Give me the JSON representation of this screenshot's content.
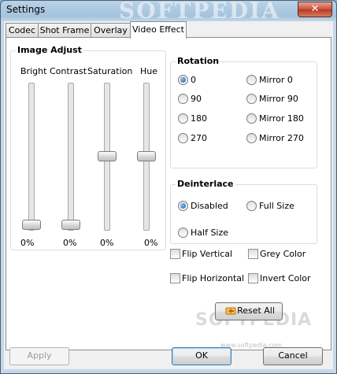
{
  "window": {
    "title": "Settings",
    "watermark": "SOFTPEDIA",
    "close_glyph": "✕"
  },
  "tabs": [
    {
      "label": "Codec",
      "active": false
    },
    {
      "label": "Shot Frame",
      "active": false
    },
    {
      "label": "Overlay",
      "active": false
    },
    {
      "label": "Video Effect",
      "active": true
    }
  ],
  "image_adjust": {
    "title": "Image Adjust",
    "sliders": [
      {
        "label": "Bright",
        "value_text": "0%",
        "level": 0
      },
      {
        "label": "Contrast",
        "value_text": "0%",
        "level": 0
      },
      {
        "label": "Saturation",
        "value_text": "0%",
        "level": 0.5
      },
      {
        "label": "Hue",
        "value_text": "0%",
        "level": 0.5
      }
    ]
  },
  "rotation": {
    "title": "Rotation",
    "options": [
      {
        "label": "0",
        "checked": true
      },
      {
        "label": "Mirror 0",
        "checked": false
      },
      {
        "label": "90",
        "checked": false
      },
      {
        "label": "Mirror 90",
        "checked": false
      },
      {
        "label": "180",
        "checked": false
      },
      {
        "label": "Mirror 180",
        "checked": false
      },
      {
        "label": "270",
        "checked": false
      },
      {
        "label": "Mirror 270",
        "checked": false
      }
    ]
  },
  "deinterlace": {
    "title": "Deinterlace",
    "options": [
      {
        "label": "Disabled",
        "checked": true
      },
      {
        "label": "Full Size",
        "checked": false
      },
      {
        "label": "Half Size",
        "checked": false
      }
    ]
  },
  "checkboxes": [
    {
      "label": "Flip Vertical",
      "checked": false
    },
    {
      "label": "Grey Color",
      "checked": false
    },
    {
      "label": "Flip Horizontal",
      "checked": false
    },
    {
      "label": "Invert Color",
      "checked": false
    }
  ],
  "buttons": {
    "reset_all": "Reset All",
    "apply": "Apply",
    "ok": "OK",
    "cancel": "Cancel"
  },
  "watermark_url": "www.softpedia.com",
  "colors": {
    "accent": "#1f63a8",
    "title_bar": "#a5c3dc",
    "close_red": "#c8503a"
  }
}
